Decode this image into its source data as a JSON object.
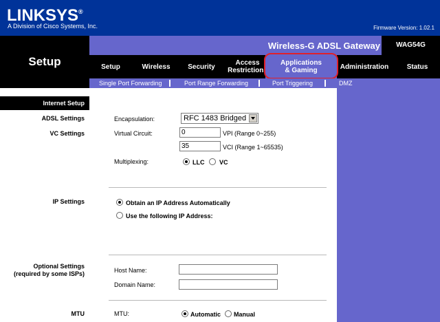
{
  "header": {
    "logo": "LINKSYS",
    "logo_mark": "®",
    "tagline": "A Division of Cisco Systems, Inc.",
    "firmware": "Firmware Version: 1.02.1"
  },
  "section_title": "Setup",
  "product": {
    "name": "Wireless-G ADSL Gateway",
    "model": "WAG54G"
  },
  "tabs": [
    {
      "label": "Setup"
    },
    {
      "label": "Wireless"
    },
    {
      "label": "Security"
    },
    {
      "label_1": "Access",
      "label_2": "Restrictions"
    },
    {
      "label_1": "Applications",
      "label_2": "& Gaming"
    },
    {
      "label": "Administration"
    },
    {
      "label": "Status"
    }
  ],
  "subtabs": [
    "Single Port Forwarding",
    "Port Range Forwarding",
    "Port Triggering",
    "DMZ"
  ],
  "sidebar": {
    "internet_setup": "Internet Setup",
    "adsl_settings": "ADSL Settings",
    "vc_settings": "VC Settings",
    "ip_settings": "IP Settings",
    "optional_settings_1": "Optional Settings",
    "optional_settings_2": "(required by some ISPs)",
    "mtu": "MTU"
  },
  "form": {
    "encapsulation_label": "Encapsulation:",
    "encapsulation_value": "RFC 1483 Bridged",
    "virtual_circuit_label": "Virtual Circuit:",
    "vpi_value": "0",
    "vpi_label": "VPI (Range 0~255)",
    "vci_value": "35",
    "vci_label": "VCI (Range 1~65535)",
    "multiplexing_label": "Multiplexing:",
    "llc_label": "LLC",
    "vc_label": "VC",
    "obtain_ip_label": "Obtain an IP Address Automatically",
    "use_ip_label": "Use the following IP Address:",
    "host_name_label": "Host Name:",
    "host_name_value": "",
    "domain_name_label": "Domain Name:",
    "domain_name_value": "",
    "mtu_label": "MTU:",
    "mtu_auto_label": "Automatic",
    "mtu_manual_label": "Manual"
  },
  "colors": {
    "header_blue": "#003399",
    "nav_purple": "#6666cc",
    "highlight_red": "#e0202a"
  }
}
